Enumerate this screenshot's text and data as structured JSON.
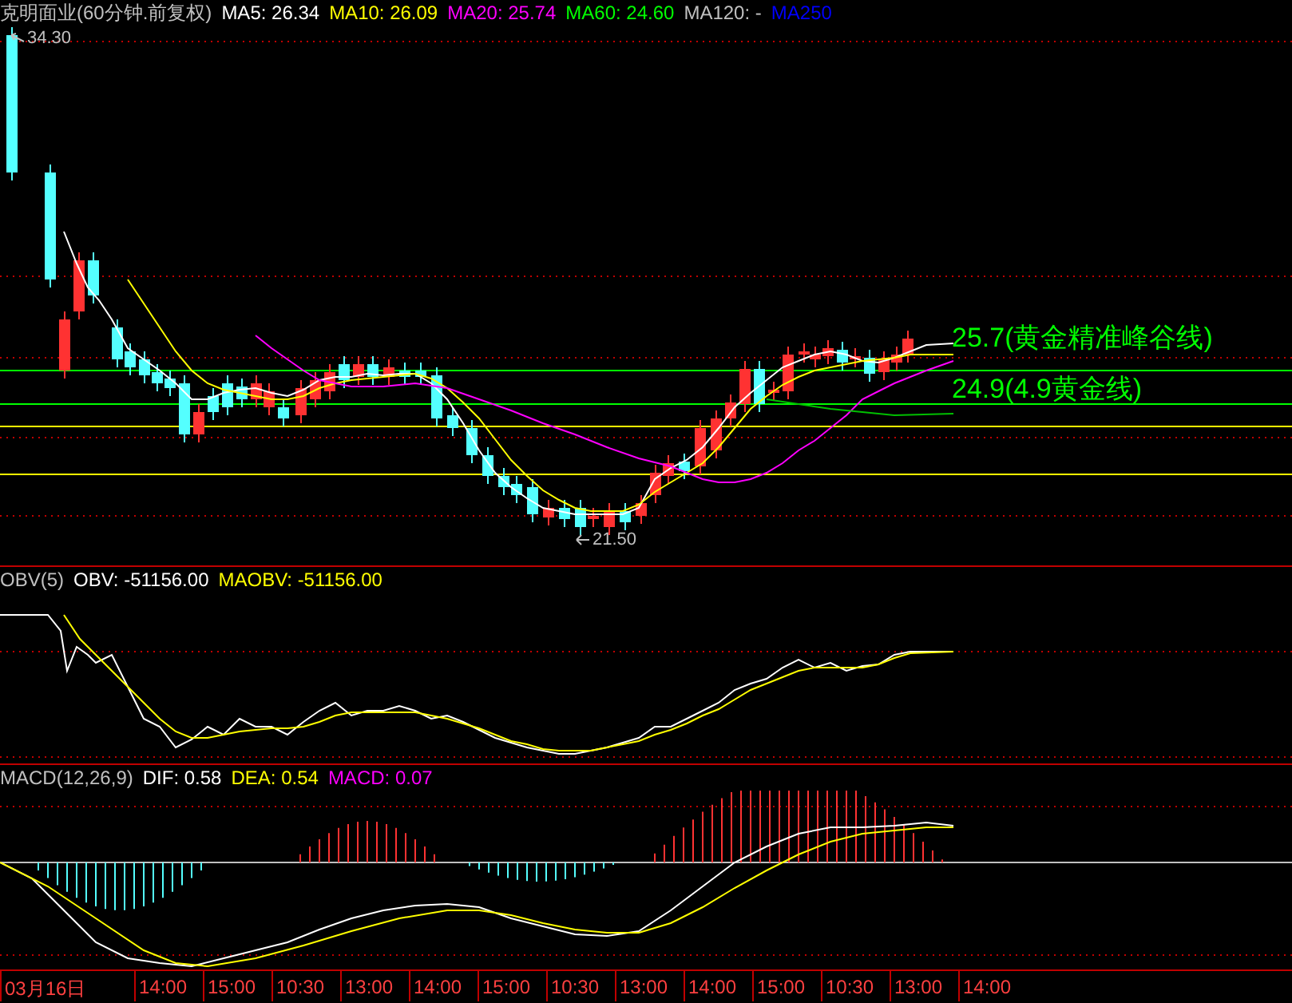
{
  "main_panel": {
    "title": "克明面业(60分钟.前复权)",
    "indicators": [
      {
        "label": "MA5: 26.34",
        "color": "#ffffff"
      },
      {
        "label": "MA10: 26.09",
        "color": "#ffff00"
      },
      {
        "label": "MA20: 25.74",
        "color": "#ff00ff"
      },
      {
        "label": "MA60: 24.60",
        "color": "#00ff00"
      },
      {
        "label": "MA120: -",
        "color": "#c0c0c0"
      },
      {
        "label": "MA250",
        "color": "#0000ff"
      }
    ],
    "high_marker": "34.30",
    "low_marker": "21.50",
    "annotations": [
      "25.7(黄金精准峰谷线)",
      "24.9(4.9黄金线)"
    ]
  },
  "obv_panel": {
    "title": "OBV(5)",
    "indicators": [
      {
        "label": "OBV: -51156.00",
        "color": "#ffffff"
      },
      {
        "label": "MAOBV: -51156.00",
        "color": "#ffff00"
      }
    ]
  },
  "macd_panel": {
    "title": "MACD(12,26,9)",
    "indicators": [
      {
        "label": "DIF: 0.58",
        "color": "#ffffff"
      },
      {
        "label": "DEA: 0.54",
        "color": "#ffff00"
      },
      {
        "label": "MACD: 0.07",
        "color": "#ff00ff"
      }
    ]
  },
  "time_axis": [
    "03月16日",
    "14:00",
    "15:00",
    "10:30",
    "13:00",
    "14:00",
    "15:00",
    "10:30",
    "13:00",
    "14:00",
    "15:00",
    "10:30",
    "13:00",
    "14:00"
  ]
}
